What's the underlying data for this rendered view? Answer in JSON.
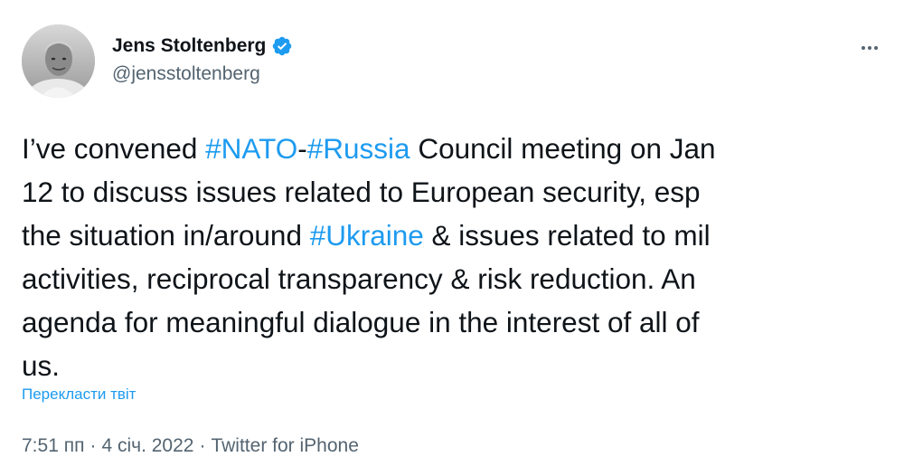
{
  "author": {
    "display_name": "Jens Stoltenberg",
    "handle": "@jensstoltenberg",
    "verified": true,
    "verified_color": "#1d9bf0"
  },
  "tweet": {
    "lines": [
      [
        {
          "text": "I’ve convened ",
          "type": "text"
        },
        {
          "text": "#NATO",
          "type": "hashtag"
        },
        {
          "text": "-",
          "type": "text"
        },
        {
          "text": "#Russia",
          "type": "hashtag"
        },
        {
          "text": " Council meeting on Jan",
          "type": "text"
        }
      ],
      [
        {
          "text": "12 to discuss issues related to European security, esp",
          "type": "text"
        }
      ],
      [
        {
          "text": "the situation in/around ",
          "type": "text"
        },
        {
          "text": "#Ukraine",
          "type": "hashtag"
        },
        {
          "text": " & issues related to mil",
          "type": "text"
        }
      ],
      [
        {
          "text": "activities, reciprocal transparency & risk reduction. An",
          "type": "text"
        }
      ],
      [
        {
          "text": "agenda for meaningful dialogue in the interest of all of",
          "type": "text"
        }
      ],
      [
        {
          "text": "us.",
          "type": "text"
        }
      ]
    ],
    "translate_label": "Перекласти твіт"
  },
  "meta": {
    "time": "7:51 пп",
    "date": "4 січ. 2022",
    "source": "Twitter for iPhone",
    "separator": "·"
  },
  "icons": {
    "more": "more-horizontal-icon",
    "verified": "verified-badge-icon"
  },
  "colors": {
    "accent": "#1d9bf0",
    "text": "#0f1419",
    "secondary": "#536471"
  }
}
